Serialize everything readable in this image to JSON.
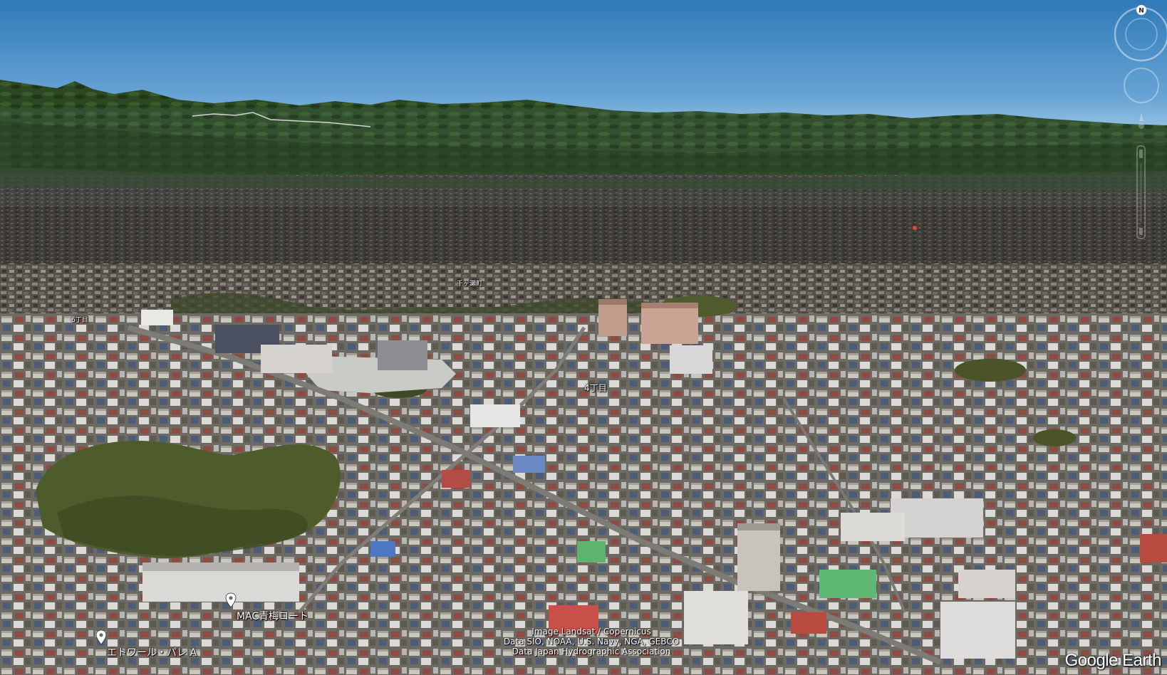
{
  "map": {
    "view": "3d-aerial",
    "sky_color": "#2f79b8",
    "horizon_color": "#9cc7e6",
    "mountain_color": "#2e4a24",
    "urban_color": "#5a5448"
  },
  "labels": {
    "place_far": "千ヶ瀬町",
    "district_left": "6丁目",
    "district_center": "4丁目",
    "poi_1": "MAC青梅コート",
    "poi_2": "エトワール・パレ A"
  },
  "attribution": {
    "line1": "Image Landsat / Copernicus",
    "line2": "Data SIO, NOAA, U.S. Navy, NGA, GEBCO",
    "line3": "Data Japan Hydrographic Association"
  },
  "logo": "Google Earth",
  "controls": {
    "compass_letter": "N",
    "compass_icon": "compass-ring-icon",
    "look_icon": "look-joystick-icon",
    "pegman_icon": "street-view-icon",
    "zoom_icon": "zoom-slider-icon"
  }
}
